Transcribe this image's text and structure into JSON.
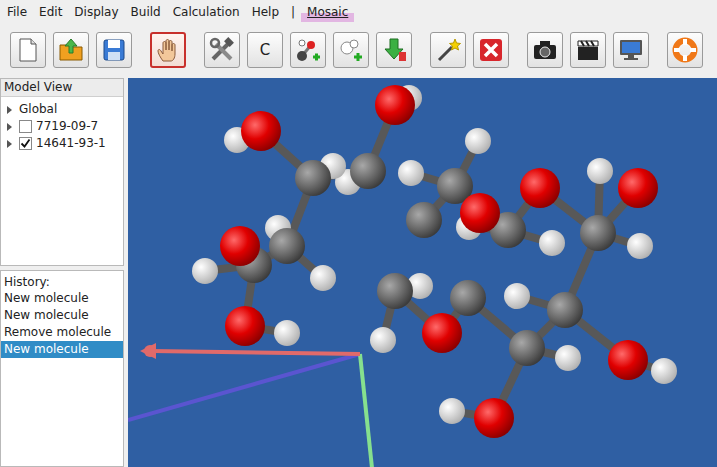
{
  "menus": [
    {
      "label": "File",
      "highlighted": false
    },
    {
      "label": "Edit",
      "highlighted": false
    },
    {
      "label": "Display",
      "highlighted": false
    },
    {
      "label": "Build",
      "highlighted": false
    },
    {
      "label": "Calculation",
      "highlighted": false
    },
    {
      "label": "Help",
      "highlighted": false
    },
    {
      "label": "|",
      "highlighted": false
    },
    {
      "label": "Mosaic",
      "highlighted": true
    }
  ],
  "toolbar": [
    [
      {
        "selected": false
      },
      {
        "selected": false
      },
      {
        "selected": false
      }
    ],
    [
      {
        "selected": true
      }
    ],
    [
      {
        "selected": false
      },
      {
        "text": "C",
        "selected": false
      },
      {
        "selected": false
      },
      {
        "selected": false
      },
      {
        "selected": false
      }
    ],
    [
      {
        "selected": false
      },
      {
        "selected": false
      }
    ],
    [
      {
        "selected": false
      },
      {
        "selected": false
      },
      {
        "selected": false
      }
    ],
    [
      {
        "selected": false
      }
    ]
  ],
  "model_view": {
    "title": "Model View",
    "items": [
      {
        "label": "Global",
        "kind": "plain",
        "expanded": false
      },
      {
        "label": "7719-09-7",
        "kind": "check",
        "expanded": false,
        "checked": false
      },
      {
        "label": "14641-93-1",
        "kind": "check",
        "expanded": false,
        "checked": true
      }
    ]
  },
  "history": {
    "title": "History:",
    "items": [
      {
        "label": "New molecule",
        "selected": false
      },
      {
        "label": "New molecule",
        "selected": false
      },
      {
        "label": "Remove molecule",
        "selected": false
      },
      {
        "label": "New molecule",
        "selected": true
      }
    ]
  }
}
